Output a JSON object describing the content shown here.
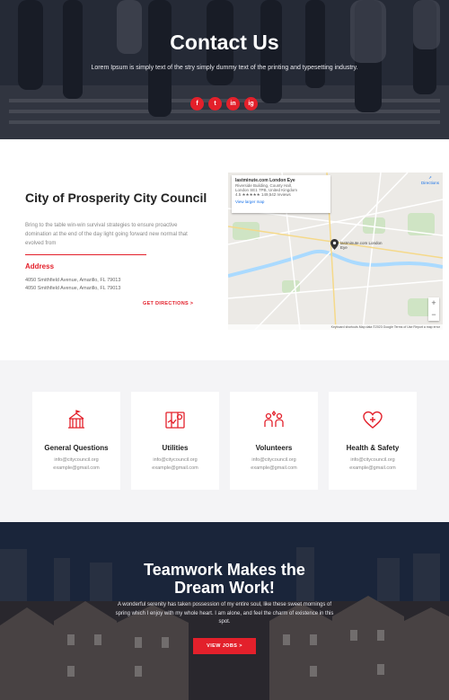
{
  "hero": {
    "title": "Contact Us",
    "subtitle": "Lorem Ipsum is simply text of the stry simply dummy text of the printing and typesetting industry.",
    "socials": [
      "f",
      "t",
      "in",
      "ig"
    ]
  },
  "contact": {
    "title": "City of Prosperity City Council",
    "description": "Bring to the table win-win survival strategies to ensure proactive domination at the end of the day light going forward new normal that evolved from",
    "address_label": "Address",
    "address_lines": [
      "4050 Smithfield Avenue, Amarillo, FL 79013",
      "4050 Smithfield Avenue, Amarillo, FL 79013"
    ],
    "directions_label": "GET DIRECTIONS >"
  },
  "map": {
    "card_title": "lastminute.com London Eye",
    "card_line1": "Riverside Building, County Hall,",
    "card_line2": "London SE1 7PB, United Kingdom",
    "rating": "4.5",
    "reviews": "149,542 reviews",
    "larger_map": "View larger map",
    "directions": "Directions",
    "pin_label": "lastminute.com London Eye",
    "footer": "Keyboard shortcuts   Map data ©2023 Google   Terms of Use   Report a map error"
  },
  "cards": [
    {
      "title": "General Questions",
      "line1": "info@citycouncil.org",
      "line2": "example@gmail.com",
      "icon": "city-hall-icon"
    },
    {
      "title": "Utilities",
      "line1": "info@citycouncil.org",
      "line2": "example@gmail.com",
      "icon": "utilities-map-icon"
    },
    {
      "title": "Volunteers",
      "line1": "info@citycouncil.org",
      "line2": "example@gmail.com",
      "icon": "volunteers-icon"
    },
    {
      "title": "Health & Safety",
      "line1": "info@citycouncil.org",
      "line2": "example@gmail.com",
      "icon": "health-heart-icon"
    }
  ],
  "banner": {
    "title_line1": "Teamwork Makes the",
    "title_line2": "Dream Work!",
    "text": "A wonderful serenity has taken possession of my entire soul, like these sweet mornings of spring which I enjoy with my whole heart. I am alone, and feel the charm of existence in this spot.",
    "button": "VIEW JOBS >"
  },
  "colors": {
    "accent": "#e3202b",
    "dark": "#222222",
    "muted": "#888888"
  }
}
